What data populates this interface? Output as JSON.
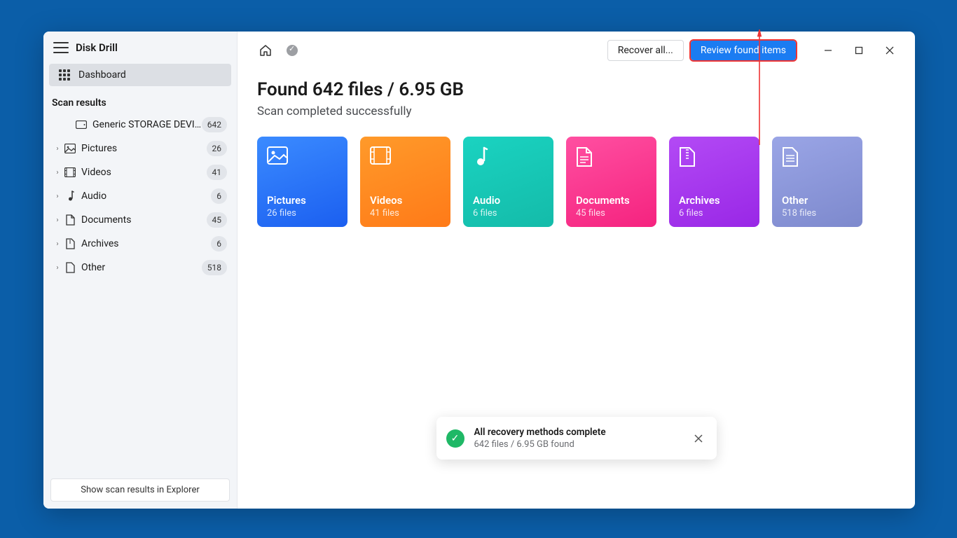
{
  "app": {
    "title": "Disk Drill"
  },
  "sidebar": {
    "dashboard_label": "Dashboard",
    "section_label": "Scan results",
    "device": {
      "label": "Generic STORAGE DEVIC...",
      "count": "642"
    },
    "items": [
      {
        "label": "Pictures",
        "count": "26"
      },
      {
        "label": "Videos",
        "count": "41"
      },
      {
        "label": "Audio",
        "count": "6"
      },
      {
        "label": "Documents",
        "count": "45"
      },
      {
        "label": "Archives",
        "count": "6"
      },
      {
        "label": "Other",
        "count": "518"
      }
    ],
    "explorer_button": "Show scan results in Explorer"
  },
  "toolbar": {
    "recover_label": "Recover all...",
    "review_label": "Review found items"
  },
  "main": {
    "headline": "Found 642 files / 6.95 GB",
    "subline": "Scan completed successfully"
  },
  "cards": [
    {
      "title": "Pictures",
      "sub": "26 files"
    },
    {
      "title": "Videos",
      "sub": "41 files"
    },
    {
      "title": "Audio",
      "sub": "6 files"
    },
    {
      "title": "Documents",
      "sub": "45 files"
    },
    {
      "title": "Archives",
      "sub": "6 files"
    },
    {
      "title": "Other",
      "sub": "518 files"
    }
  ],
  "toast": {
    "title": "All recovery methods complete",
    "sub": "642 files / 6.95 GB found"
  }
}
